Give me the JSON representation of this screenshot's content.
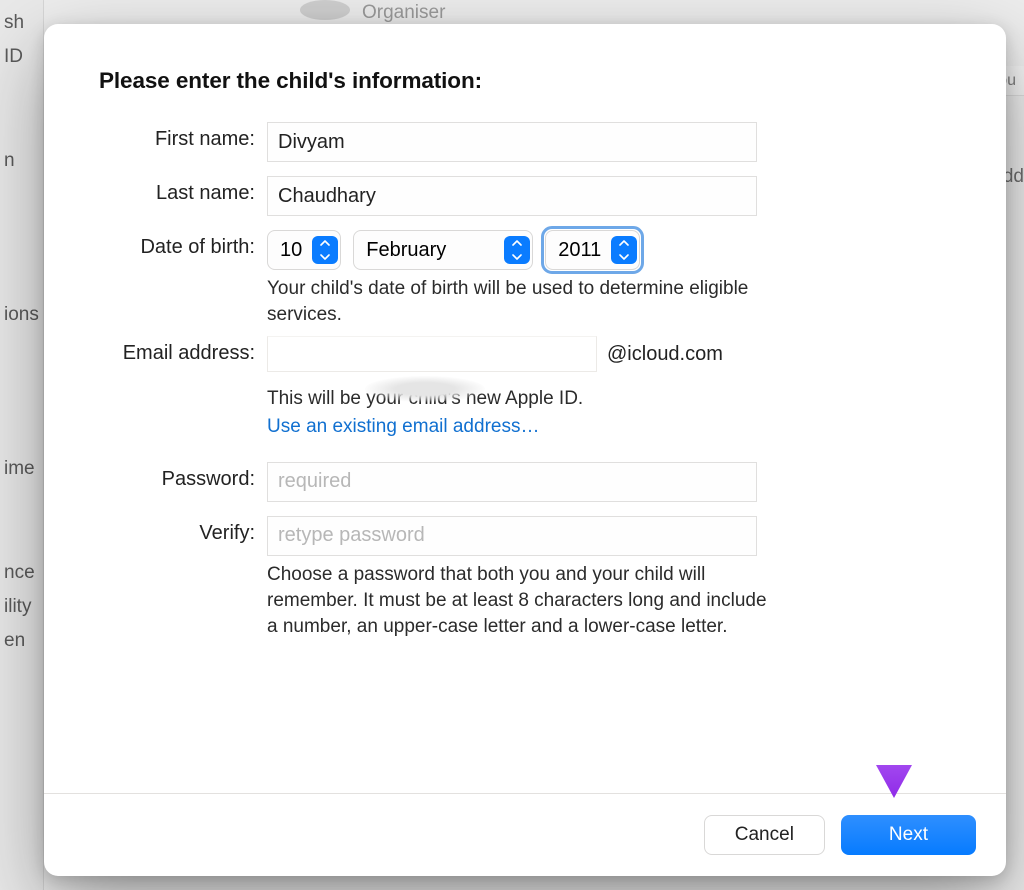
{
  "background": {
    "organiser": "Organiser",
    "sidebar_fragments": [
      "sh",
      "ID",
      "",
      "",
      "n",
      "",
      "",
      "ions",
      "",
      "",
      "",
      "ime",
      "",
      "",
      "nce",
      "ility",
      "en"
    ],
    "right_fragment_top": "ccou",
    "right_fragment_add": "Add"
  },
  "title": "Please enter the child's information:",
  "labels": {
    "first_name": "First name:",
    "last_name": "Last name:",
    "dob": "Date of birth:",
    "email": "Email address:",
    "password": "Password:",
    "verify": "Verify:"
  },
  "values": {
    "first_name": "Divyam",
    "last_name": "Chaudhary",
    "dob_day": "10",
    "dob_month": "February",
    "dob_year": "2011",
    "email_local": "",
    "email_suffix": "@icloud.com"
  },
  "helpers": {
    "dob": "Your child's date of birth will be used to determine eligible services.",
    "email_note": "This will be your child's new Apple ID.",
    "email_link": "Use an existing email address…",
    "password": "Choose a password that both you and your child will remember. It must be at least 8 characters long and include a number, an upper-case letter and a lower-case letter."
  },
  "placeholders": {
    "password": "required",
    "verify": "retype password"
  },
  "buttons": {
    "cancel": "Cancel",
    "next": "Next"
  }
}
